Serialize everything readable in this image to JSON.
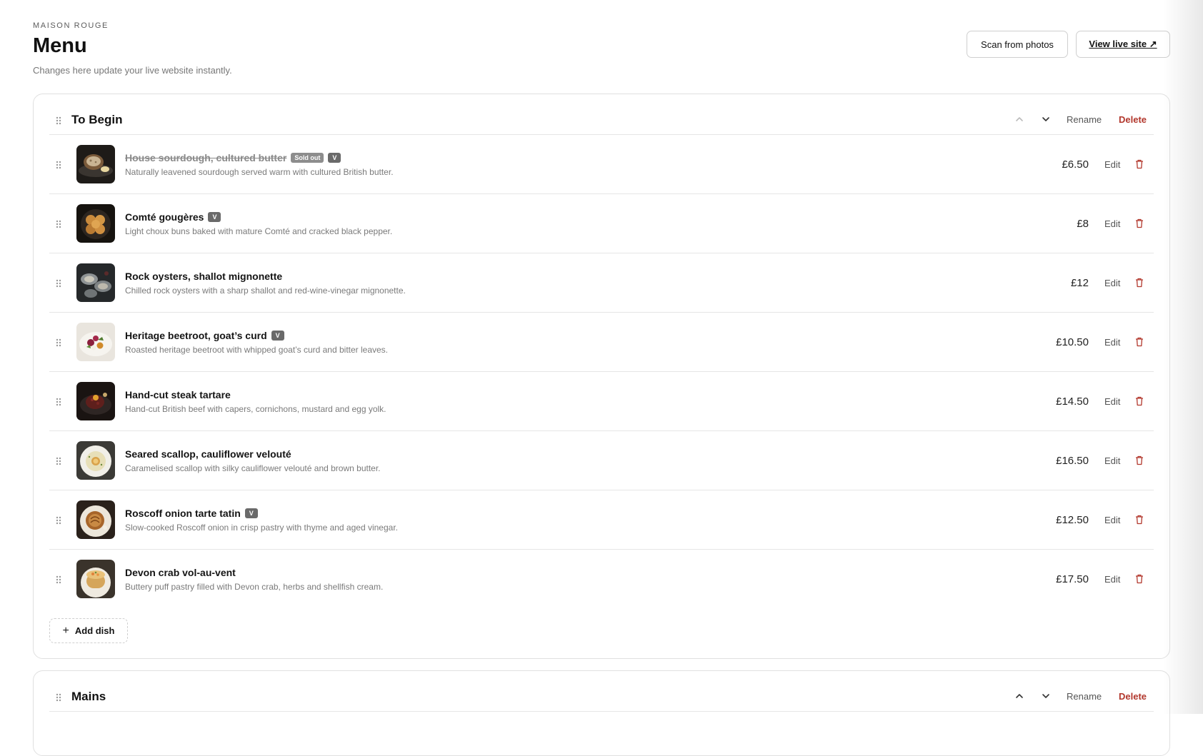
{
  "header": {
    "brand": "MAISON ROUGE",
    "title": "Menu",
    "subtitle": "Changes here update your live website instantly.",
    "scan_label": "Scan from photos",
    "live_label": "View live site ↗"
  },
  "section_actions": {
    "rename": "Rename",
    "delete": "Delete"
  },
  "item_actions": {
    "edit": "Edit"
  },
  "badges": {
    "sold_out": "Sold out",
    "vegetarian": "V"
  },
  "sections": [
    {
      "name": "To Begin",
      "add_label": "Add dish",
      "items": [
        {
          "name": "House sourdough, cultured butter",
          "description": "Naturally leavened sourdough served warm with cultured British butter.",
          "price": "£6.50",
          "sold_out": true,
          "vegetarian": true,
          "photo": "sourdough-bread"
        },
        {
          "name": "Comté gougères",
          "description": "Light choux buns baked with mature Comté and cracked black pepper.",
          "price": "£8",
          "sold_out": false,
          "vegetarian": true,
          "photo": "gougeres"
        },
        {
          "name": "Rock oysters, shallot mignonette",
          "description": "Chilled rock oysters with a sharp shallot and red-wine-vinegar mignonette.",
          "price": "£12",
          "sold_out": false,
          "vegetarian": false,
          "photo": "oysters"
        },
        {
          "name": "Heritage beetroot, goat’s curd",
          "description": "Roasted heritage beetroot with whipped goat’s curd and bitter leaves.",
          "price": "£10.50",
          "sold_out": false,
          "vegetarian": true,
          "photo": "beetroot-salad"
        },
        {
          "name": "Hand-cut steak tartare",
          "description": "Hand-cut British beef with capers, cornichons, mustard and egg yolk.",
          "price": "£14.50",
          "sold_out": false,
          "vegetarian": false,
          "photo": "steak-tartare"
        },
        {
          "name": "Seared scallop, cauliflower velouté",
          "description": "Caramelised scallop with silky cauliflower velouté and brown butter.",
          "price": "£16.50",
          "sold_out": false,
          "vegetarian": false,
          "photo": "scallop"
        },
        {
          "name": "Roscoff onion tarte tatin",
          "description": "Slow-cooked Roscoff onion in crisp pastry with thyme and aged vinegar.",
          "price": "£12.50",
          "sold_out": false,
          "vegetarian": true,
          "photo": "tarte-tatin"
        },
        {
          "name": "Devon crab vol-au-vent",
          "description": "Buttery puff pastry filled with Devon crab, herbs and shellfish cream.",
          "price": "£17.50",
          "sold_out": false,
          "vegetarian": false,
          "photo": "vol-au-vent"
        }
      ]
    },
    {
      "name": "Mains",
      "items": []
    }
  ],
  "colors": {
    "danger": "#b2372c",
    "border": "#e0e0e0",
    "muted_text": "#7a7a7a"
  }
}
